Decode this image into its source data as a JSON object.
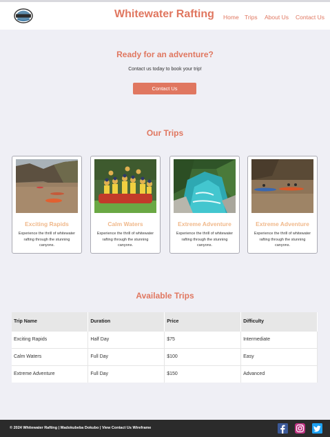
{
  "header": {
    "site_title": "Whitewater Rafting",
    "logo_alt": "logo",
    "nav": [
      "Home",
      "Trips",
      "About Us",
      "Contact Us"
    ]
  },
  "cta": {
    "title": "Ready for an adventure?",
    "text": "Contact us today to book your trip!",
    "button_label": "Contact Us"
  },
  "trips_section": {
    "title": "Our Trips",
    "cards": [
      {
        "title": "Exciting Rapids",
        "desc": "Experience the thrill of whitewater rafting through the stunning canyons."
      },
      {
        "title": "Calm Waters",
        "desc": "Experience the thrill of whitewater rafting through the stunning canyons."
      },
      {
        "title": "Extreme Adventure",
        "desc": "Experience the thrill of whitewater rafting through the stunning canyons."
      },
      {
        "title": "Extreme Adventure",
        "desc": "Experience the thrill of whitewater rafting through the stunning canyons."
      }
    ]
  },
  "available_section": {
    "title": "Available Trips",
    "columns": [
      "Trip Name",
      "Duration",
      "Price",
      "Difficulty"
    ],
    "rows": [
      [
        "Exciting Rapids",
        "Half Day",
        "$75",
        "Intermediate"
      ],
      [
        "Calm Waters",
        "Full Day",
        "$100",
        "Easy"
      ],
      [
        "Extreme Adventure",
        "Full Day",
        "$150",
        "Advanced"
      ]
    ]
  },
  "footer": {
    "text": "© 2024 Whitewater Rafting | Madokubeba Dokubo | View Contact Us Wireframe",
    "social": [
      "facebook-icon",
      "instagram-icon",
      "twitter-icon"
    ]
  },
  "colors": {
    "accent": "#e07760",
    "card_title": "#f0b88a",
    "background": "#efeff5",
    "footer": "#2b2b2b"
  }
}
